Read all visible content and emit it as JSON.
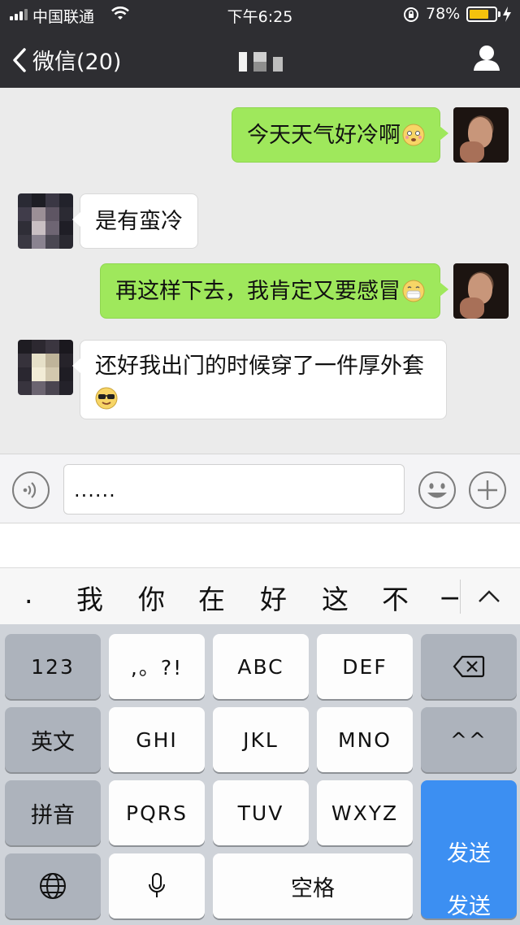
{
  "status_bar": {
    "carrier": "中国联通",
    "time": "下午6:25",
    "battery_percent_text": "78%",
    "battery_level": 0.78,
    "battery_color": "#f4c20d",
    "icons": [
      "signal-icon",
      "wifi-icon",
      "orientation-lock-icon",
      "battery-icon",
      "charging-bolt-icon"
    ]
  },
  "nav": {
    "back_label": "微信(20)",
    "title": "",
    "icons": [
      "back-chevron-icon",
      "contact-profile-icon"
    ]
  },
  "messages": [
    {
      "from": "me",
      "text": "今天天气好冷啊",
      "emoji": "cold-face-emoji"
    },
    {
      "from": "friend",
      "text": "是有蛮冷",
      "emoji": ""
    },
    {
      "from": "me",
      "text": "再这样下去，我肯定又要感冒",
      "emoji": "mask-face-emoji"
    },
    {
      "from": "friend",
      "text": "还好我出门的时候穿了一件厚外套",
      "emoji": "sunglasses-face-emoji"
    }
  ],
  "input": {
    "value": "......",
    "icons": [
      "voice-icon",
      "emoji-icon",
      "add-icon"
    ]
  },
  "candidates": {
    "items": [
      ".",
      "我",
      "你",
      "在",
      "好",
      "这",
      "不",
      "一"
    ],
    "icon": "collapse-chevron-icon"
  },
  "keyboard": {
    "keys": {
      "num": "123",
      "punct": ",。?!",
      "abc": "ABC",
      "def": "DEF",
      "en": "英文",
      "ghi": "GHI",
      "jkl": "JKL",
      "mno": "MNO",
      "face": "^^",
      "pinyin": "拼音",
      "pqrs": "PQRS",
      "tuv": "TUV",
      "wxyz": "WXYZ",
      "send": "发送",
      "space": "空格"
    },
    "send_sub_label": "发送",
    "icons": [
      "delete-icon",
      "globe-icon",
      "microphone-icon"
    ],
    "send_color": "#3c8ff2"
  },
  "colors": {
    "header_bg": "#2e2e32",
    "chat_bg": "#ebebeb",
    "bubble_me": "#9fe85c",
    "bubble_friend": "#ffffff"
  }
}
